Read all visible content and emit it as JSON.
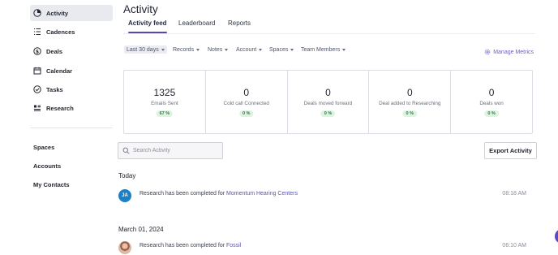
{
  "sidebar": {
    "items": [
      {
        "label": "Activity",
        "icon": "pie-chart-icon",
        "active": true
      },
      {
        "label": "Cadences",
        "icon": "list-icon"
      },
      {
        "label": "Deals",
        "icon": "dollar-icon"
      },
      {
        "label": "Calendar",
        "icon": "calendar-icon"
      },
      {
        "label": "Tasks",
        "icon": "check-circle-icon"
      },
      {
        "label": "Research",
        "icon": "research-icon"
      }
    ],
    "links": [
      {
        "label": "Spaces"
      },
      {
        "label": "Accounts"
      },
      {
        "label": "My Contacts"
      }
    ]
  },
  "main": {
    "title": "Activity",
    "tabs": [
      {
        "label": "Activity feed",
        "active": true
      },
      {
        "label": "Leaderboard"
      },
      {
        "label": "Reports"
      }
    ],
    "filters": [
      {
        "label": "Last 30 days"
      },
      {
        "label": "Records"
      },
      {
        "label": "Notes"
      },
      {
        "label": "Account"
      },
      {
        "label": "Spaces"
      },
      {
        "label": "Team Members"
      }
    ],
    "manage_metrics": "Manage Metrics",
    "metrics": [
      {
        "value": "1325",
        "label": "Emails Sent",
        "badge": "67 %"
      },
      {
        "value": "0",
        "label": "Cold call Connected",
        "badge": "0 %"
      },
      {
        "value": "0",
        "label": "Deals moved forward",
        "badge": "0 %"
      },
      {
        "value": "0",
        "label": "Deal added to Researching",
        "badge": "0 %"
      },
      {
        "value": "0",
        "label": "Deals won",
        "badge": "0 %"
      }
    ],
    "search": {
      "placeholder": "Search Activity",
      "value": ""
    },
    "export_label": "Export Activity",
    "feed": [
      {
        "group": "Today",
        "rows": [
          {
            "avatar": "JA",
            "text": "Research has been completed for ",
            "link": "Momentum Hearing Centers",
            "time": "08:18 AM"
          }
        ]
      },
      {
        "group": "March 01, 2024",
        "rows": [
          {
            "avatar": "",
            "text": "Research has been completed for ",
            "link": "Fossil",
            "time": "06:10 AM"
          }
        ]
      }
    ]
  },
  "colors": {
    "accent": "#5b46b6",
    "link": "#5c55b2",
    "badge_bg": "#dff3e2",
    "badge_text": "#2d7a3a",
    "avatar_ja": "#1e7fc4"
  }
}
